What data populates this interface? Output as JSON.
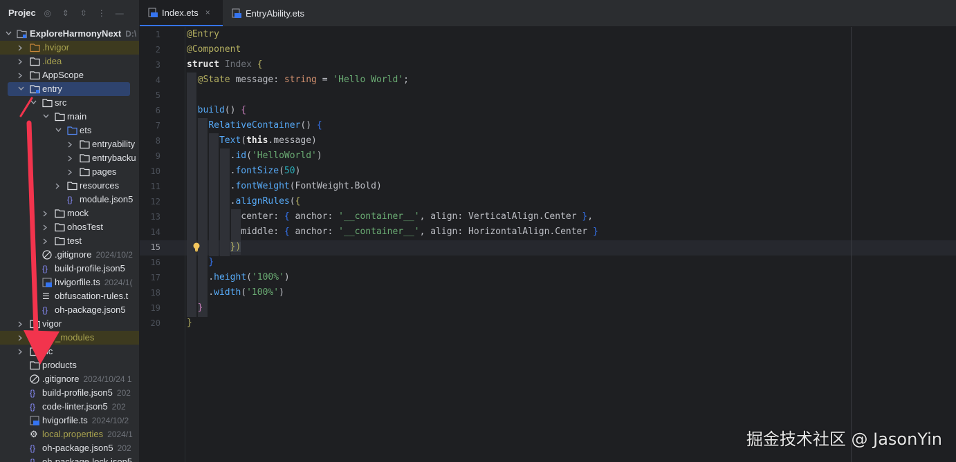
{
  "project_panel": {
    "title": "Projec",
    "icons": [
      "target-icon",
      "expand-icon",
      "collapse-icon",
      "more-icon",
      "minimize-icon"
    ],
    "root": {
      "label": "ExploreHarmonyNext",
      "path": "D:\\"
    },
    "items": [
      {
        "label": ".hvigor",
        "meta": ""
      },
      {
        "label": ".idea",
        "meta": ""
      },
      {
        "label": "AppScope",
        "meta": ""
      },
      {
        "label": "entry",
        "meta": ""
      },
      {
        "label": "src",
        "meta": ""
      },
      {
        "label": "main",
        "meta": ""
      },
      {
        "label": "ets",
        "meta": ""
      },
      {
        "label": "entryability",
        "meta": ""
      },
      {
        "label": "entrybacku",
        "meta": ""
      },
      {
        "label": "pages",
        "meta": ""
      },
      {
        "label": "resources",
        "meta": ""
      },
      {
        "label": "module.json5",
        "meta": ""
      },
      {
        "label": "mock",
        "meta": ""
      },
      {
        "label": "ohosTest",
        "meta": ""
      },
      {
        "label": "test",
        "meta": ""
      },
      {
        "label": ".gitignore",
        "meta": "2024/10/2"
      },
      {
        "label": "build-profile.json5",
        "meta": ""
      },
      {
        "label": "hvigorfile.ts",
        "meta": "2024/1("
      },
      {
        "label": "obfuscation-rules.t",
        "meta": ""
      },
      {
        "label": "oh-package.json5",
        "meta": ""
      },
      {
        "label": "vigor",
        "meta": ""
      },
      {
        "label": "_modules",
        "meta": ""
      },
      {
        "label": "lic",
        "meta": ""
      },
      {
        "label": "products",
        "meta": ""
      },
      {
        "label": ".gitignore",
        "meta": "2024/10/24 1"
      },
      {
        "label": "build-profile.json5",
        "meta": "202"
      },
      {
        "label": "code-linter.json5",
        "meta": "202"
      },
      {
        "label": "hvigorfile.ts",
        "meta": "2024/10/2"
      },
      {
        "label": "local.properties",
        "meta": "2024/1"
      },
      {
        "label": "oh-package.json5",
        "meta": "202"
      },
      {
        "label": "oh-package-lock.json5",
        "meta": ""
      }
    ]
  },
  "tabs": [
    {
      "label": "Index.ets",
      "close": "×"
    },
    {
      "label": "EntryAbility.ets"
    }
  ],
  "editor": {
    "line_numbers": [
      "1",
      "2",
      "3",
      "4",
      "5",
      "6",
      "7",
      "8",
      "9",
      "10",
      "11",
      "12",
      "13",
      "14",
      "15",
      "16",
      "17",
      "18",
      "19",
      "20"
    ],
    "current_line": "15"
  },
  "watermark": "掘金技术社区 @ JasonYin"
}
